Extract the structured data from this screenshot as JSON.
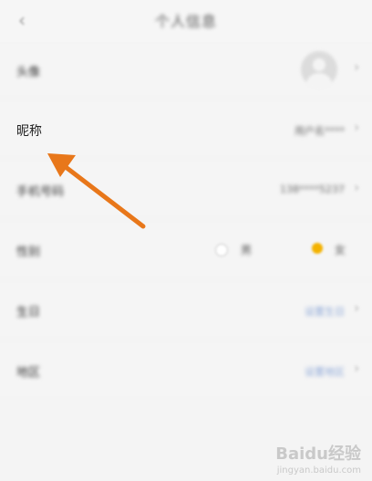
{
  "header": {
    "back_icon": "chevron-left-icon",
    "title": "个人信息"
  },
  "rows": {
    "avatar": {
      "label": "头像"
    },
    "nickname": {
      "label": "昵称",
      "value": "用户名****"
    },
    "phone": {
      "label": "手机号码",
      "value": "138****5237"
    },
    "gender": {
      "label": "性别",
      "option_male": "男",
      "option_female": "女",
      "selected": "女"
    },
    "birthday": {
      "label": "生日",
      "value": "设置生日"
    },
    "extra": {
      "label": "地区",
      "value": "设置地区"
    }
  },
  "watermark": {
    "logo": "Baidu经验",
    "url": "jingyan.baidu.com"
  },
  "colors": {
    "arrow": "#e8771a",
    "accent_selected": "#f3b200",
    "link_value": "#8fa9d8"
  }
}
